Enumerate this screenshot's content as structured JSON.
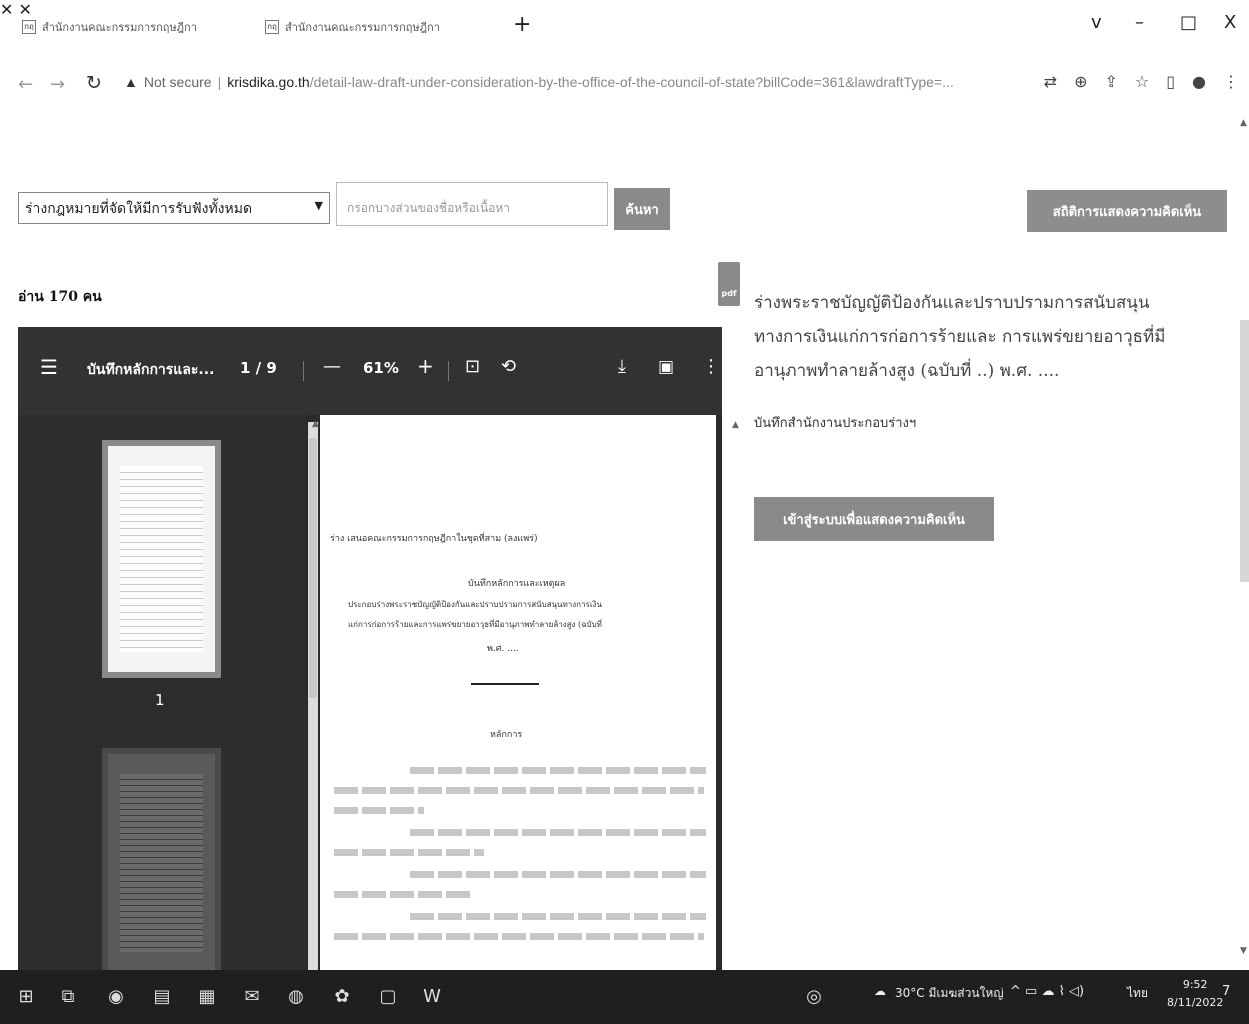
{
  "browser": {
    "tabs": [
      {
        "label": "สำนักงานคณะกรรมการกฤษฎีกา",
        "favicon": "กฤ"
      },
      {
        "label": "สำนักงานคณะกรรมการกฤษฎีกา",
        "favicon": "กฤ"
      }
    ],
    "new_tab": "+",
    "window_controls": [
      "v",
      "–",
      "□",
      "X"
    ],
    "address": {
      "security": "Not secure",
      "host": "krisdika.go.th",
      "path": "/detail-law-draft-under-consideration-by-the-office-of-the-council-of-state?billCode=361&lawdraftType=..."
    }
  },
  "controls": {
    "filter_value": "ร่างกฎหมายที่จัดให้มีการรับฟังทั้งหมด",
    "search_placeholder": "กรอกบางส่วนของชื่อหรือเนื้อหา",
    "search_button": "ค้นหา",
    "stats_button": "สถิติการแสดงความคิดเห็น"
  },
  "reads": "อ่าน 170 คน",
  "pdf_viewer": {
    "title": "บันทึกหลักการและ...",
    "page_indicator": "1 / 9",
    "zoom": "61%",
    "thumbnail_label": "1",
    "page_texts": {
      "header": "ร่าง เสนอคณะกรรมการกฤษฎีกาในชุดที่สาม (ลงแพร่)",
      "memo": "บันทึกหลักการและเหตุผล",
      "l1": "ประกอบร่างพระราชบัญญัติป้องกันและปราบปรามการสนับสนุนทางการเงิน",
      "l2": "แก่การก่อการร้ายและการแพร่ขยายอาวุธที่มีอานุภาพทำลายล้างสูง (ฉบับที่",
      "l3": "พ.ศ. ....",
      "principle": "หลักการ"
    }
  },
  "info": {
    "doc_title": "ร่างพระราชบัญญัติป้องกันและปราบปรามการสนับสนุนทางการเงินแก่การก่อการร้ายและ การแพร่ขยายอาวุธที่มีอานุภาพทำลายล้างสูง (ฉบับที่ ..) พ.ศ. ....",
    "doc_sub": "บันทึกสำนักงานประกอบร่างฯ",
    "enter_button": "เข้าสู่ระบบเพื่อแสดงความคิดเห็น",
    "pdf_label": "pdf"
  },
  "taskbar": {
    "weather": "30°C มีเมฆส่วนใหญ่",
    "lang": "ไทย",
    "time": "9:52",
    "date": "8/11/2022",
    "notifications": "7"
  }
}
